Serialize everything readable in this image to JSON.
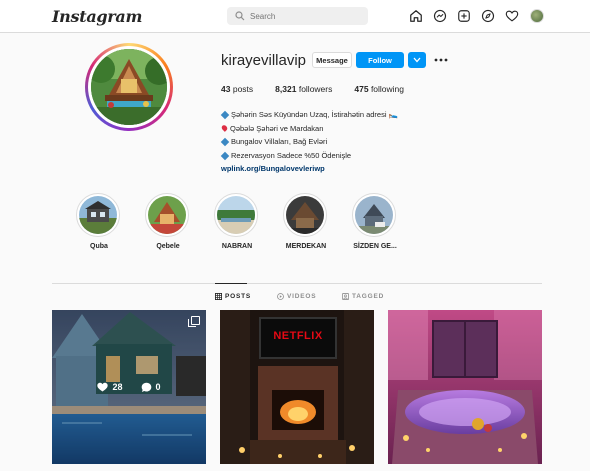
{
  "nav": {
    "logo": "Instagram",
    "search_placeholder": "Search",
    "icons": [
      "home-icon",
      "messenger-icon",
      "new-post-icon",
      "explore-icon",
      "activity-heart-icon",
      "profile-avatar"
    ]
  },
  "profile": {
    "username": "kirayevillavip",
    "message_label": "Message",
    "follow_label": "Follow",
    "stats": {
      "posts_count": "43",
      "posts_label": "posts",
      "followers_count": "8,321",
      "followers_label": "followers",
      "following_count": "475",
      "following_label": "following"
    },
    "bio": {
      "line1": "Şəhərin Səs Küyündən Uzaq, İstirahətin adresi 🛌",
      "line2": "Qəbələ Şəhəri ve Mardakan",
      "line3": "Bungalov Villaları, Bağ Evləri",
      "line4": "Rezervasyon Sadece %50 Ödenişle",
      "link": "wplink.org/Bungalovevleriwp"
    }
  },
  "highlights": [
    {
      "label": "Quba"
    },
    {
      "label": "Qebele"
    },
    {
      "label": "NABRAN"
    },
    {
      "label": "MERDEKAN"
    },
    {
      "label": "SİZDEN GE..."
    }
  ],
  "tabs": {
    "posts": "POSTS",
    "videos": "VIDEOS",
    "tagged": "TAGGED"
  },
  "posts": [
    {
      "likes": "28",
      "comments": "0",
      "multi": true
    },
    {
      "sign_text": "NETFLIX"
    },
    {}
  ],
  "colors": {
    "accent": "#0095f6",
    "link": "#00376b",
    "border": "#dbdbdb"
  }
}
